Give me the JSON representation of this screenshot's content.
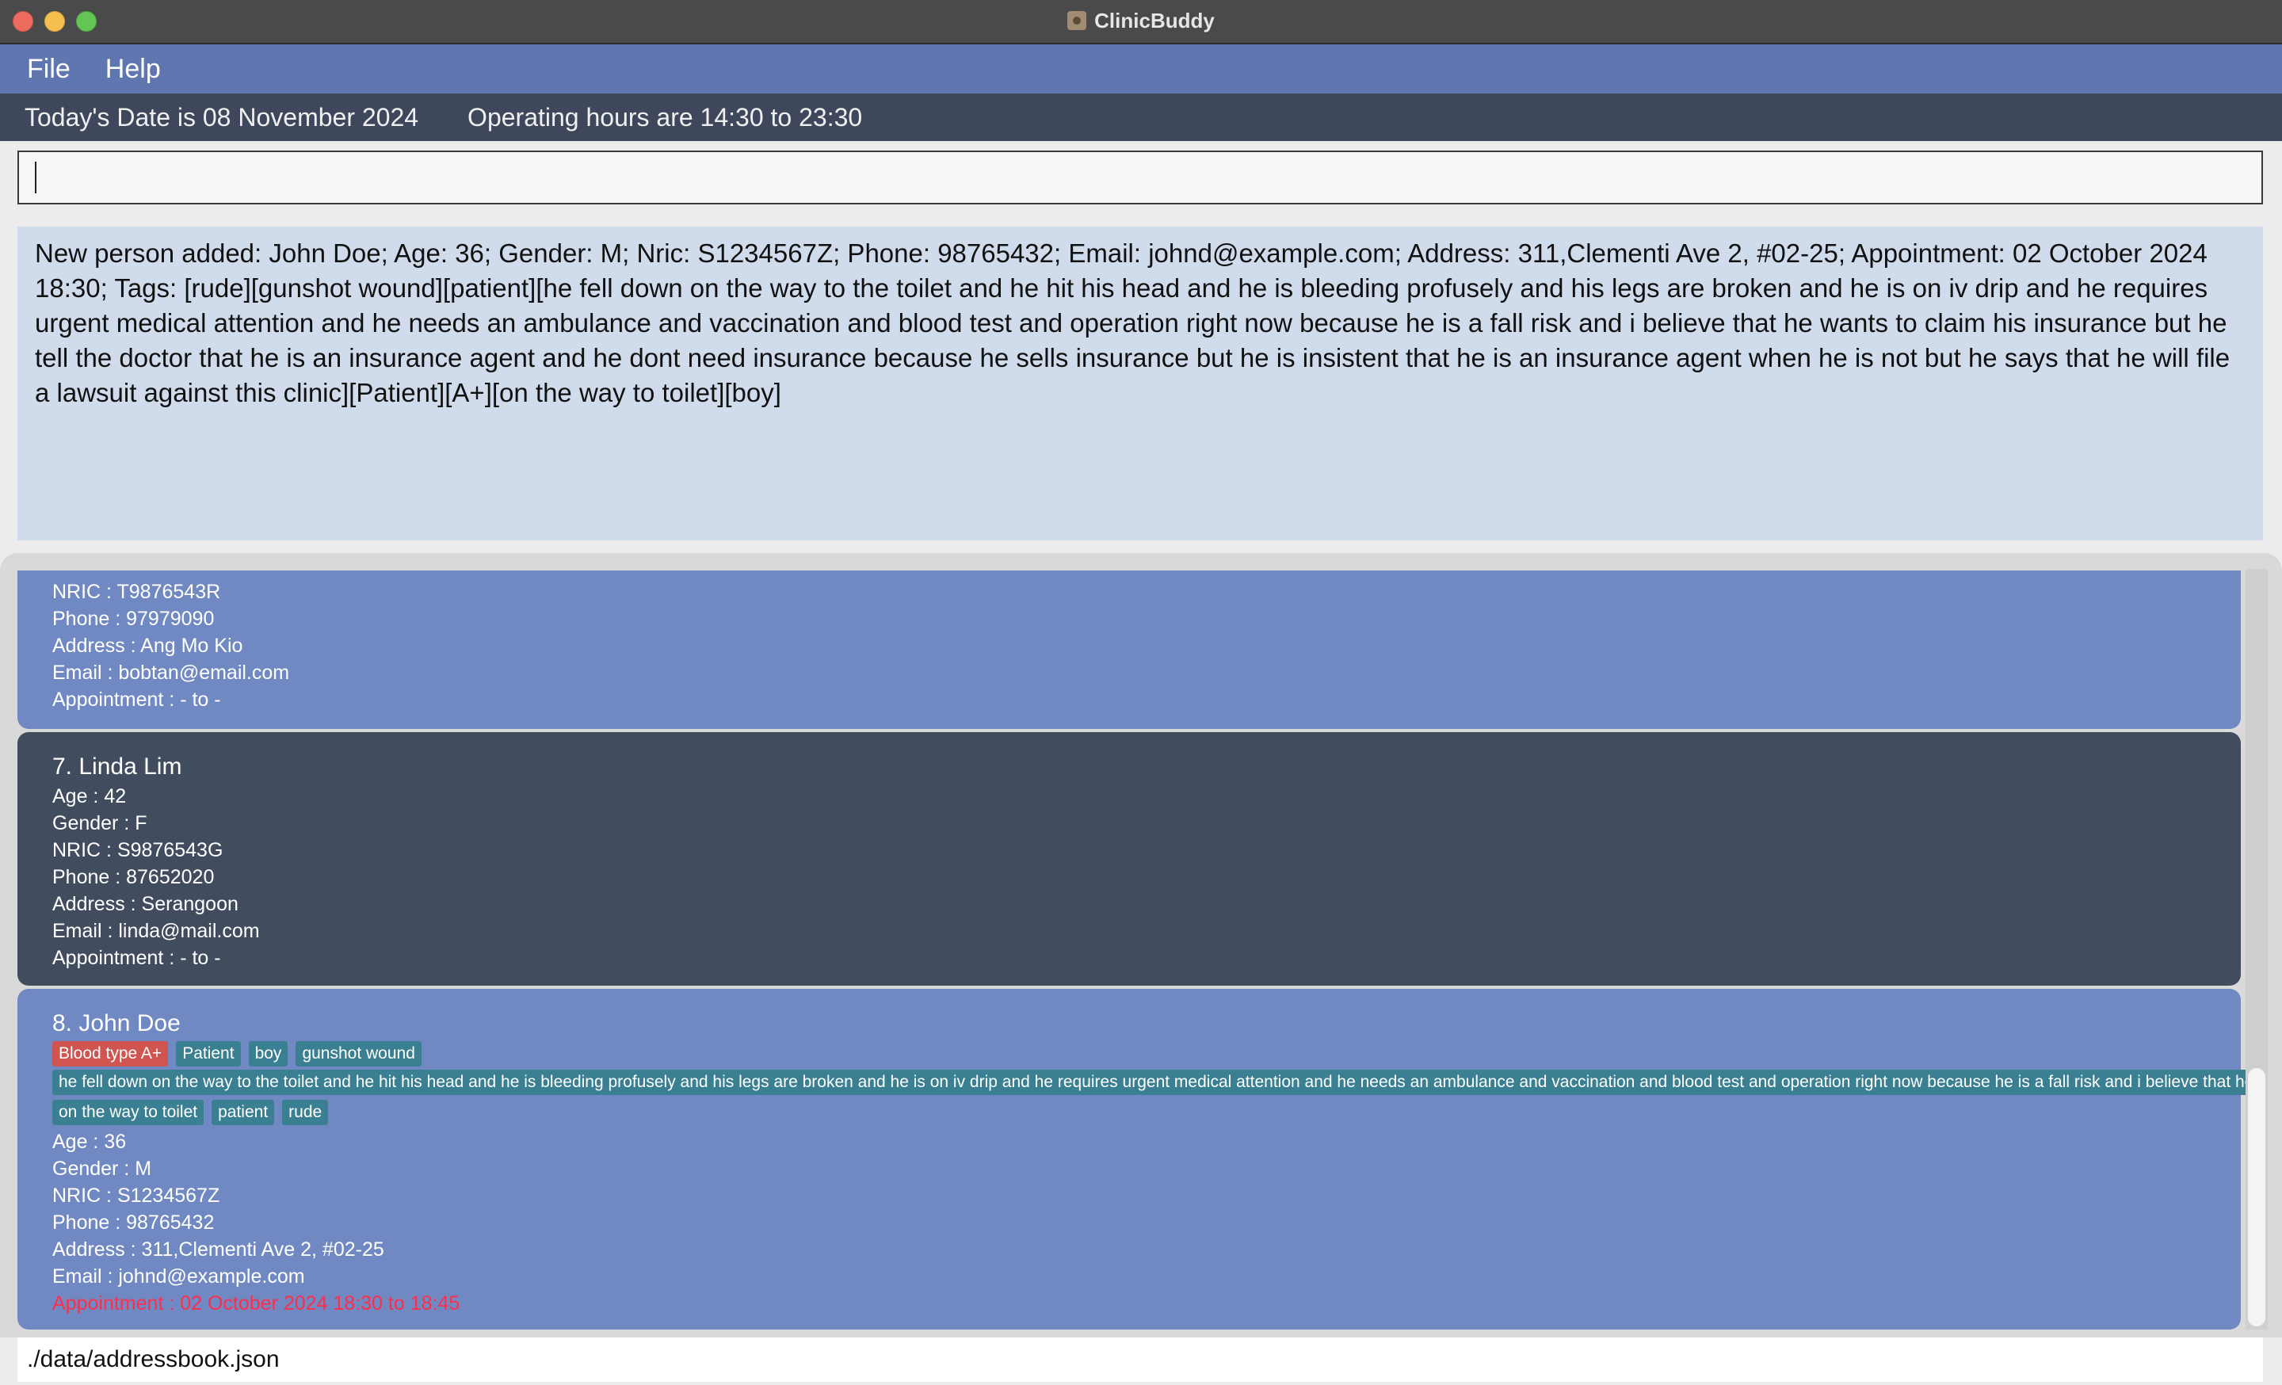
{
  "window": {
    "title": "ClinicBuddy"
  },
  "menu": {
    "items": [
      "File",
      "Help"
    ]
  },
  "status": {
    "date": "Today's Date is 08 November 2024",
    "hours": "Operating hours are 14:30 to 23:30"
  },
  "command": {
    "value": ""
  },
  "result": {
    "text": "New person added: John Doe; Age: 36; Gender: M; Nric: S1234567Z; Phone: 98765432; Email: johnd@example.com; Address: 311,Clementi Ave 2, #02-25; Appointment: 02 October 2024 18:30; Tags: [rude][gunshot wound][patient][he fell down on the way to the toilet and he hit his head and he is bleeding profusely and his legs are broken and he is on iv drip and he requires urgent medical attention and he needs an ambulance and vaccination and blood test and operation right now because he is a fall risk and i believe that he wants to claim his insurance but he tell the doctor that he is an insurance agent and he dont need insurance because he sells insurance but he is insistent that he is an insurance agent when he is not but he says that he will file a lawsuit against this clinic][Patient][A+][on the way to toilet][boy]"
  },
  "persons": [
    {
      "nric": "NRIC : T9876543R",
      "phone": "Phone : 97979090",
      "address": "Address : Ang Mo Kio",
      "email": "Email : bobtan@email.com",
      "appointment": "Appointment : - to -"
    },
    {
      "name": "7. Linda Lim",
      "age": "Age : 42",
      "gender": "Gender : F",
      "nric": "NRIC : S9876543G",
      "phone": "Phone : 87652020",
      "address": "Address : Serangoon",
      "email": "Email : linda@mail.com",
      "appointment": "Appointment : - to -"
    },
    {
      "name": "8. John Doe",
      "tags_row1": [
        "Blood type A+",
        "Patient",
        "boy",
        "gunshot wound"
      ],
      "long_tag": "he fell down on the way to the toilet and he hit his head and he is bleeding profusely and his legs are broken and he is on iv drip and he requires urgent medical attention and he needs an ambulance and vaccination and blood test and operation right now because he is a fall risk and i believe that he wants t",
      "tags_row3": [
        "on the way to toilet",
        "patient",
        "rude"
      ],
      "age": "Age : 36",
      "gender": "Gender : M",
      "nric": "NRIC : S1234567Z",
      "phone": "Phone : 98765432",
      "address": "Address : 311,Clementi Ave 2, #02-25",
      "email": "Email : johnd@example.com",
      "appointment": "Appointment : 02 October 2024 18:30 to 18:45"
    }
  ],
  "footer": {
    "path": "./data/addressbook.json"
  },
  "colors": {
    "menu_bg": "#5f76b0",
    "status_bg": "#3f475c",
    "card_blue": "#7189c3",
    "card_dark": "#424c5f",
    "tag_bg": "#3b8092",
    "tag_bloodtype": "#d0544f",
    "appointment_alert": "#ff2d4a"
  }
}
